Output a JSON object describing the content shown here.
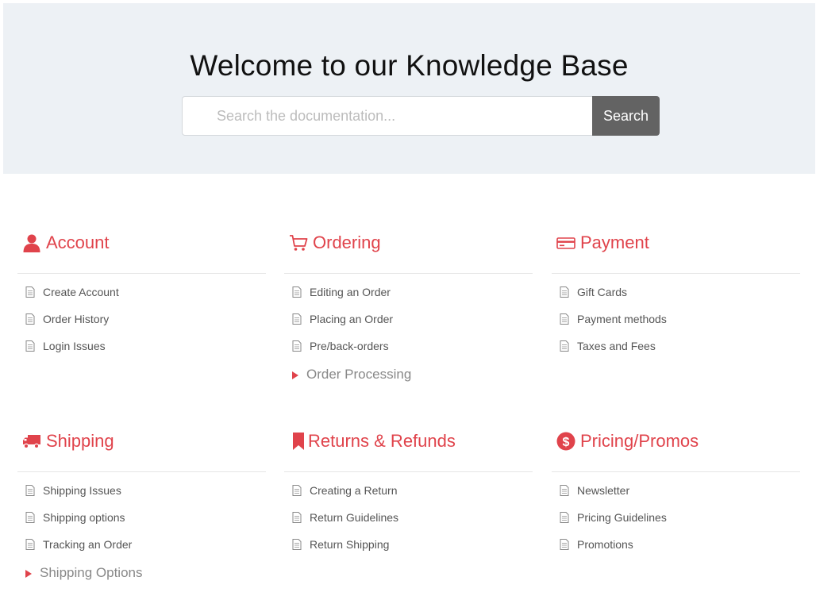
{
  "hero": {
    "title": "Welcome to our Knowledge Base",
    "search_placeholder": "Search the documentation...",
    "search_button": "Search"
  },
  "colors": {
    "accent": "#e0434b",
    "hero_bg": "#edf1f5",
    "search_button_bg": "#636363"
  },
  "categories": [
    {
      "title": "Account",
      "icon": "user-icon",
      "articles": [
        "Create Account",
        "Order History",
        "Login Issues"
      ],
      "subcategory": null
    },
    {
      "title": "Ordering",
      "icon": "cart-icon",
      "articles": [
        "Editing an Order",
        "Placing an Order",
        "Pre/back-orders"
      ],
      "subcategory": "Order Processing"
    },
    {
      "title": "Payment",
      "icon": "credit-card-icon",
      "articles": [
        "Gift Cards",
        "Payment methods",
        "Taxes and Fees"
      ],
      "subcategory": null
    },
    {
      "title": "Shipping",
      "icon": "truck-icon",
      "articles": [
        "Shipping Issues",
        "Shipping options",
        "Tracking an Order"
      ],
      "subcategory": "Shipping Options"
    },
    {
      "title": "Returns & Refunds",
      "icon": "bookmark-icon",
      "articles": [
        "Creating a Return",
        "Return Guidelines",
        "Return Shipping"
      ],
      "subcategory": null
    },
    {
      "title": "Pricing/Promos",
      "icon": "dollar-circle-icon",
      "articles": [
        "Newsletter",
        "Pricing Guidelines",
        "Promotions"
      ],
      "subcategory": null
    }
  ]
}
